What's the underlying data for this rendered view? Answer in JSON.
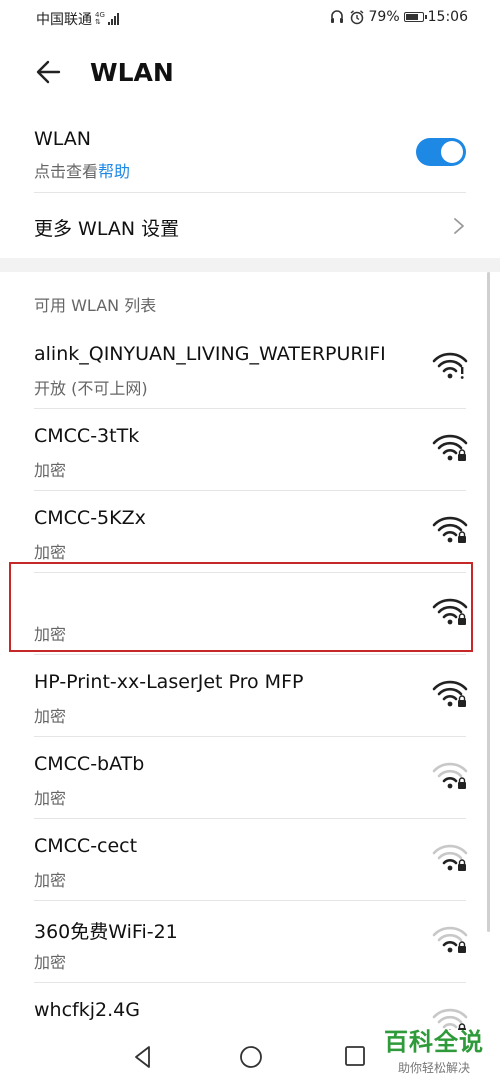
{
  "status_bar": {
    "carrier": "中国联通",
    "network_type": "4G",
    "battery_percent": "79%",
    "battery_level": 0.79,
    "time": "15:06",
    "icons": [
      "headset-icon",
      "alarm-icon",
      "battery-icon"
    ]
  },
  "header": {
    "title": "WLAN",
    "back_icon": "arrow-left-icon"
  },
  "wlan_toggle": {
    "label": "WLAN",
    "help_prefix": "点击查看",
    "help_link": "帮助",
    "enabled": true,
    "accent_color": "#1e88e5"
  },
  "more_settings": {
    "label": "更多 WLAN 设置"
  },
  "list": {
    "header": "可用 WLAN 列表",
    "networks": [
      {
        "ssid": "alink_QINYUAN_LIVING_WATERPURIFI",
        "security": "开放 (不可上网)",
        "icon": "wifi-warning-icon",
        "strength": 4
      },
      {
        "ssid": "CMCC-3tTk",
        "security": "加密",
        "icon": "wifi-lock-icon",
        "strength": 4
      },
      {
        "ssid": "CMCC-5KZx",
        "security": "加密",
        "icon": "wifi-lock-icon",
        "strength": 4
      },
      {
        "ssid": "",
        "security": "加密",
        "icon": "wifi-lock-icon",
        "strength": 4,
        "obscured": true
      },
      {
        "ssid": "HP-Print-xx-LaserJet Pro MFP",
        "security": "加密",
        "icon": "wifi-lock-icon",
        "strength": 4
      },
      {
        "ssid": "CMCC-bATb",
        "security": "加密",
        "icon": "wifi-lock-icon",
        "strength": 2
      },
      {
        "ssid": "CMCC-cect",
        "security": "加密",
        "icon": "wifi-lock-icon",
        "strength": 2
      },
      {
        "ssid": "360免费WiFi-21",
        "security": "加密",
        "icon": "wifi-lock-icon",
        "strength": 2
      },
      {
        "ssid": "whcfkj2.4G",
        "security": "",
        "icon": "wifi-lock-icon",
        "strength": 1
      }
    ]
  },
  "highlight_color": "#c62828",
  "nav_bar": {
    "icons": [
      "nav-back-icon",
      "nav-home-icon",
      "nav-recent-icon"
    ]
  },
  "watermark": {
    "title": "百科全说",
    "subtitle": "助你轻松解决",
    "color": "#2e9a3a"
  }
}
